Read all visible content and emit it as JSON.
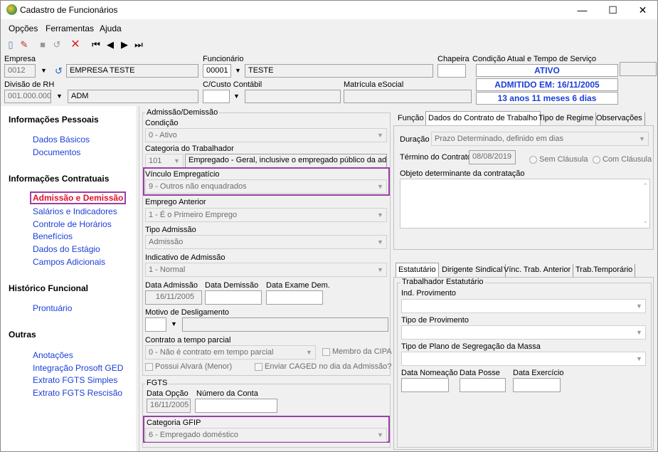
{
  "window": {
    "title": "Cadastro de Funcionários",
    "minimize": "—",
    "maximize": "☐",
    "close": "✕"
  },
  "menu": {
    "opcoes": "Opções",
    "ferramentas": "Ferramentas",
    "ajuda": "Ajuda"
  },
  "header": {
    "empresa_label": "Empresa",
    "empresa_code": "0012",
    "empresa_name": "EMPRESA TESTE",
    "funcionario_label": "Funcionário",
    "funcionario_code": "00001",
    "funcionario_name": "TESTE",
    "chapeira_label": "Chapeira",
    "chapeira_value": "",
    "condicao_label": "Condição Atual e Tempo de Serviço",
    "status_ativo": "ATIVO",
    "status_admitido": "ADMITIDO EM: 16/11/2005",
    "status_tempo": "13 anos 11 meses 6 dias",
    "divisao_label": "Divisão de RH",
    "divisao_code": "001.000.000",
    "divisao_name": "ADM",
    "custo_label": "C/Custo Contábil",
    "matricula_label": "Matrícula eSocial"
  },
  "sidebar": {
    "info_pessoais": "Informações Pessoais",
    "dados_basicos": "Dados Básicos",
    "documentos": "Documentos",
    "info_contratuais": "Informações Contratuais",
    "admissao": "Admissão e Demissão",
    "salarios": "Salários e Indicadores",
    "horarios": "Controle de Horários",
    "beneficios": "Benefícios",
    "estagio": "Dados do Estágio",
    "campos": "Campos Adicionais",
    "historico": "Histórico Funcional",
    "prontuario": "Prontuário",
    "outras": "Outras",
    "anotacoes": "Anotações",
    "ged": "Integração Prosoft GED",
    "fgts_simples": "Extrato FGTS Simples",
    "fgts_rescisao": "Extrato FGTS Rescisão"
  },
  "adm": {
    "group": "Admissão/Demissão",
    "condicao_label": "Condição",
    "condicao": "0 - Ativo",
    "categoria_label": "Categoria do Trabalhador",
    "categoria_code": "101",
    "categoria_desc": "Empregado - Geral, inclusive o empregado público da administ",
    "vinculo_label": "Vínculo Empregatício",
    "vinculo": "9 - Outros não enquadrados",
    "emprego_label": "Emprego Anterior",
    "emprego": "1 - É o Primeiro Emprego",
    "tipo_label": "Tipo Admissão",
    "tipo": "Admissão",
    "indicativo_label": "Indicativo de Admissão",
    "indicativo": "1 - Normal",
    "data_adm_label": "Data Admissão",
    "data_adm": "16/11/2005",
    "data_dem_label": "Data Demissão",
    "data_exame_label": "Data Exame Dem.",
    "motivo_label": "Motivo de Desligamento",
    "contrato_label": "Contrato a tempo parcial",
    "contrato": "0 - Não é contrato em tempo parcial",
    "cipa": "Membro da CIPA",
    "alvara": "Possui Alvará (Menor)",
    "caged": "Enviar CAGED no dia da Admissão?"
  },
  "fgts": {
    "group": "FGTS",
    "data_opcao_label": "Data Opção",
    "data_opcao": "16/11/2005",
    "conta_label": "Número da Conta",
    "gfip_label": "Categoria GFIP",
    "gfip": "6 - Empregado doméstico"
  },
  "contrato_tabs": {
    "funcao": "Função",
    "dados": "Dados do Contrato de Trabalho",
    "regime": "Tipo de Regime",
    "obs": "Observações"
  },
  "contrato": {
    "duracao_label": "Duração",
    "duracao": "Prazo Determinado, definido em dias",
    "termino_label": "Término do Contrato",
    "termino": "08/08/2019",
    "sem_clausula": "Sem Cláusula",
    "com_clausula": "Com Cláusula",
    "objeto_label": "Objeto determinante da contratação"
  },
  "estat_tabs": {
    "estatutario": "Estatutário",
    "dirigente": "Dirigente Sindical",
    "vinc": "Vínc. Trab. Anterior",
    "temp": "Trab.Temporário"
  },
  "estat": {
    "group": "Trabalhador Estatutário",
    "ind_label": "Ind. Provimento",
    "tipo_label": "Tipo de Provimento",
    "plano_label": "Tipo de Plano de Segregação da Massa",
    "nomeacao_label": "Data Nomeação",
    "posse_label": "Data Posse",
    "exercicio_label": "Data Exercício"
  }
}
